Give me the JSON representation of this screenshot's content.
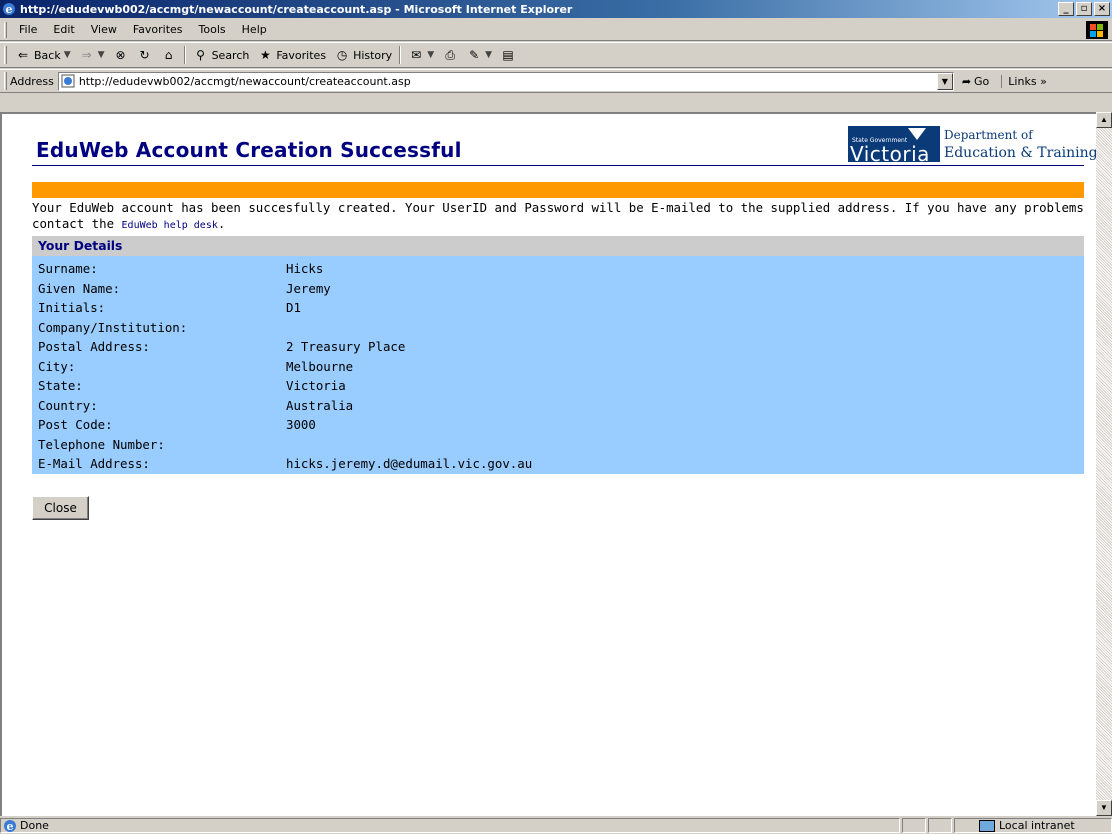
{
  "window": {
    "title": "http://edudevwb002/accmgt/newaccount/createaccount.asp - Microsoft Internet Explorer",
    "minimize": "_",
    "maximize": "̅",
    "close": "×"
  },
  "menu": [
    "File",
    "Edit",
    "View",
    "Favorites",
    "Tools",
    "Help"
  ],
  "toolbar": {
    "back": "Back",
    "search": "Search",
    "favorites": "Favorites",
    "history": "History"
  },
  "address": {
    "label": "Address",
    "url": "http://edudevwb002/accmgt/newaccount/createaccount.asp",
    "go": "Go",
    "links": "Links"
  },
  "page": {
    "title": "EduWeb Account Creation Successful",
    "logo": {
      "state_gov": "State Government",
      "victoria": "Victoria",
      "dept_line1": "Department of",
      "dept_line2": "Education & Training"
    },
    "intro_text": "Your EduWeb account has been succesfully created. Your UserID and Password will be E-mailed to the supplied address. If you have any problems contact the ",
    "help_link": "EduWeb help desk",
    "intro_end": ".",
    "details_heading": "Your Details",
    "details": [
      {
        "label": "Surname:",
        "value": "Hicks"
      },
      {
        "label": "Given Name:",
        "value": "Jeremy"
      },
      {
        "label": "Initials:",
        "value": "D1"
      },
      {
        "label": "Company/Institution:",
        "value": ""
      },
      {
        "label": "Postal Address:",
        "value": "2 Treasury Place"
      },
      {
        "label": "City:",
        "value": "Melbourne"
      },
      {
        "label": "State:",
        "value": "Victoria"
      },
      {
        "label": "Country:",
        "value": "Australia"
      },
      {
        "label": "Post Code:",
        "value": "3000"
      },
      {
        "label": "Telephone Number:",
        "value": ""
      },
      {
        "label": "E-Mail Address:",
        "value": "hicks.jeremy.d@edumail.vic.gov.au"
      }
    ],
    "close_button": "Close"
  },
  "status": {
    "text": "Done",
    "zone": "Local intranet"
  },
  "colors": {
    "title_navy": "#000080",
    "orange_bar": "#ff9900",
    "details_blue": "#99ccff",
    "details_header_grey": "#cccccc"
  }
}
